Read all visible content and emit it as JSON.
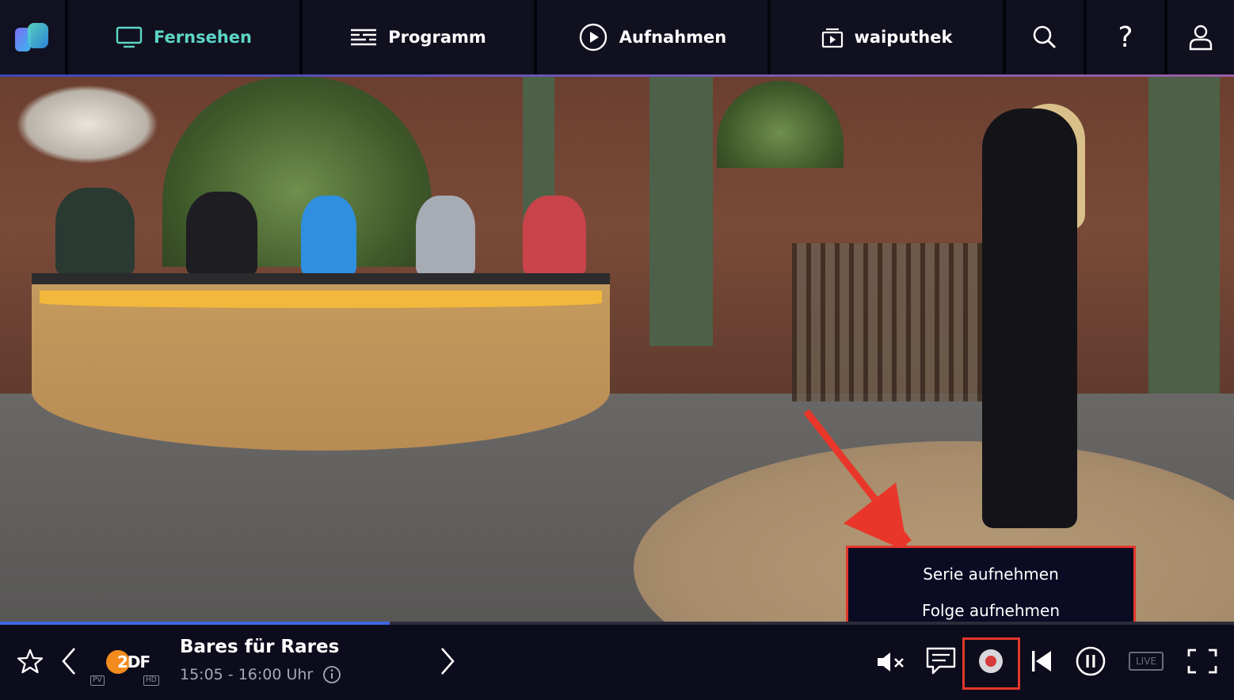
{
  "nav": {
    "tabs": [
      {
        "label": "Fernsehen",
        "icon": "tv-icon",
        "active": true
      },
      {
        "label": "Programm",
        "icon": "schedule-list-icon",
        "active": false
      },
      {
        "label": "Aufnahmen",
        "icon": "play-circle-icon",
        "active": false
      },
      {
        "label": "waiputhek",
        "icon": "media-library-icon",
        "active": false
      }
    ],
    "icons": [
      "search-icon",
      "help-icon",
      "user-icon"
    ],
    "accent_color": "#5ed6c7"
  },
  "record_menu": {
    "items": [
      "Serie aufnehmen",
      "Folge aufnehmen"
    ],
    "highlight_color": "#e2372b"
  },
  "player": {
    "progress": 0.316,
    "channel": {
      "logo_text": "2DF",
      "badges": [
        "PV",
        "HD"
      ]
    },
    "show_title": "Bares für Rares",
    "show_time": "15:05 - 16:00 Uhr",
    "live_label": "LIVE"
  }
}
